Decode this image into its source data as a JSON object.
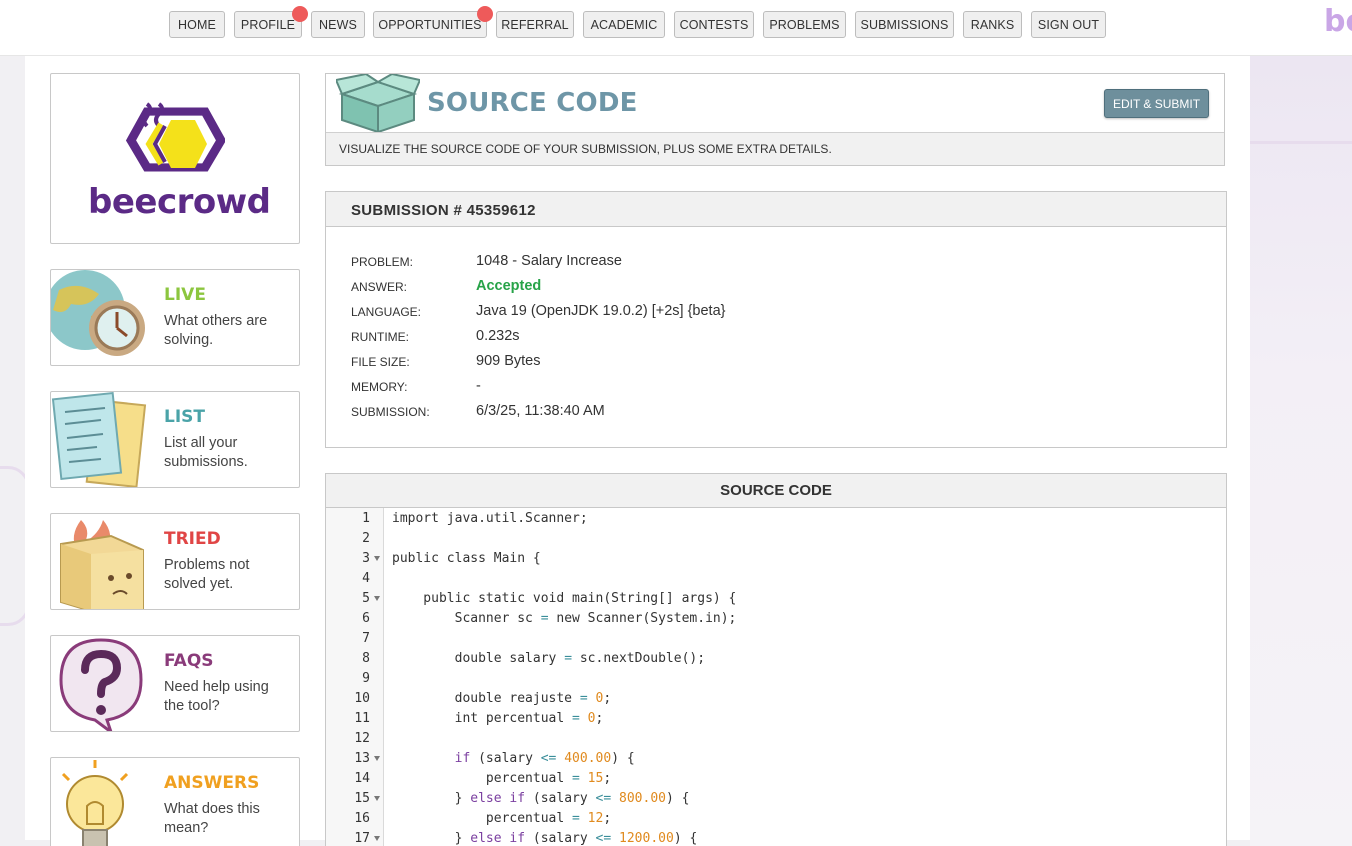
{
  "nav": {
    "items": [
      "HOME",
      "PROFILE",
      "NEWS",
      "OPPORTUNITIES",
      "REFERRAL",
      "ACADEMIC",
      "CONTESTS",
      "PROBLEMS",
      "SUBMISSIONS",
      "RANKS",
      "SIGN OUT"
    ],
    "brand_peek": "be"
  },
  "logo": {
    "text": "beecrowd"
  },
  "sidebar": {
    "cards": [
      {
        "title": "LIVE",
        "desc": "What others are solving.",
        "color": "#8cc63f"
      },
      {
        "title": "LIST",
        "desc": "List all your submissions.",
        "color": "#4aa3a8"
      },
      {
        "title": "TRIED",
        "desc": "Problems not solved yet.",
        "color": "#e04545"
      },
      {
        "title": "FAQS",
        "desc": "Need help using the tool?",
        "color": "#8a3b7a"
      },
      {
        "title": "ANSWERS",
        "desc": "What does this mean?",
        "color": "#f0a020"
      }
    ]
  },
  "header": {
    "title": "SOURCE CODE",
    "subtitle": "VISUALIZE THE SOURCE CODE OF YOUR SUBMISSION, PLUS SOME EXTRA DETAILS.",
    "edit_button": "EDIT & SUBMIT"
  },
  "submission": {
    "title": "SUBMISSION # 45359612",
    "details": [
      {
        "label": "PROBLEM:",
        "value": "1048 - Salary Increase"
      },
      {
        "label": "ANSWER:",
        "value": "Accepted"
      },
      {
        "label": "LANGUAGE:",
        "value": "Java 19 (OpenJDK 19.0.2) [+2s] {beta}"
      },
      {
        "label": "RUNTIME:",
        "value": "0.232s"
      },
      {
        "label": "FILE SIZE:",
        "value": "909 Bytes"
      },
      {
        "label": "MEMORY:",
        "value": "-"
      },
      {
        "label": "SUBMISSION:",
        "value": "6/3/25, 11:38:40 AM"
      }
    ]
  },
  "source": {
    "title": "SOURCE CODE",
    "lines": [
      {
        "n": "1",
        "code": "import java.util.Scanner;"
      },
      {
        "n": "2",
        "code": ""
      },
      {
        "n": "3",
        "code": "public class Main {",
        "fold": true
      },
      {
        "n": "4",
        "code": ""
      },
      {
        "n": "5",
        "code": "    public static void main(String[] args) {",
        "fold": true
      },
      {
        "n": "6",
        "code": "        Scanner sc = new Scanner(System.in);"
      },
      {
        "n": "7",
        "code": ""
      },
      {
        "n": "8",
        "code": "        double salary = sc.nextDouble();"
      },
      {
        "n": "9",
        "code": ""
      },
      {
        "n": "10",
        "code": "        double reajuste = 0;"
      },
      {
        "n": "11",
        "code": "        int percentual = 0;"
      },
      {
        "n": "12",
        "code": ""
      },
      {
        "n": "13",
        "code": "        if (salary <= 400.00) {",
        "fold": true
      },
      {
        "n": "14",
        "code": "            percentual = 15;"
      },
      {
        "n": "15",
        "code": "        } else if (salary <= 800.00) {",
        "fold": true
      },
      {
        "n": "16",
        "code": "            percentual = 12;"
      },
      {
        "n": "17",
        "code": "        } else if (salary <= 1200.00) {",
        "fold": true
      }
    ]
  }
}
